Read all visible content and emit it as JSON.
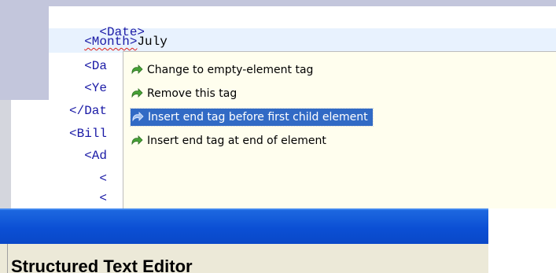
{
  "editor": {
    "lines": [
      {
        "indent": "",
        "open": "<Date>"
      },
      {
        "indent": "  ",
        "open": "<Month>",
        "text": "July"
      },
      {
        "indent": "  ",
        "open": "<Da"
      },
      {
        "indent": "  ",
        "open": "<Ye"
      },
      {
        "indent": "",
        "open": "</Dat"
      },
      {
        "indent": "",
        "open": "<Bill"
      },
      {
        "indent": "  ",
        "open": "<Ad"
      },
      {
        "indent": "    ",
        "open": "<"
      },
      {
        "indent": "    ",
        "open": "<"
      }
    ]
  },
  "quick_fix_popup": {
    "items": [
      {
        "label": "Change to empty-element tag",
        "icon": "quick-fix-arrow-icon",
        "selected": false
      },
      {
        "label": "Remove this tag",
        "icon": "quick-fix-arrow-icon",
        "selected": false
      },
      {
        "label": "Insert end tag before first child element",
        "icon": "quick-fix-arrow-icon",
        "selected": true
      },
      {
        "label": "Insert end tag at end of element",
        "icon": "quick-fix-arrow-icon",
        "selected": false
      }
    ]
  },
  "window": {
    "title": "Structured Text Editor"
  },
  "colors": {
    "titlebar": "#0b4fd4",
    "selection": "#316ac5",
    "popup_background": "#fffeee",
    "current_line": "#e8f2fe",
    "tag_color": "#1a1aa6",
    "error_squiggle": "#e0201a"
  }
}
